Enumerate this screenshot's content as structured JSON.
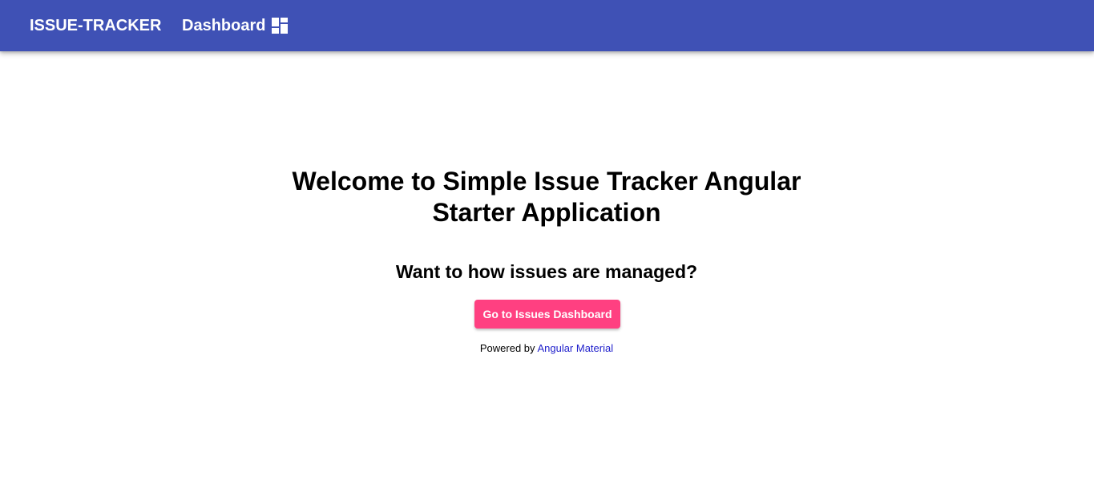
{
  "header": {
    "brand": "ISSUE-TRACKER",
    "nav_dashboard_label": "Dashboard",
    "nav_dashboard_icon": "dashboard-icon",
    "background_color": "#3f51b5"
  },
  "main": {
    "welcome_title": "Welcome to Simple Issue Tracker Angular Starter Application",
    "question": "Want to how issues are managed?",
    "cta_label": "Go to Issues Dashboard",
    "cta_color": "#ff4081",
    "powered_prefix": "Powered by",
    "powered_link": "Angular Material"
  }
}
